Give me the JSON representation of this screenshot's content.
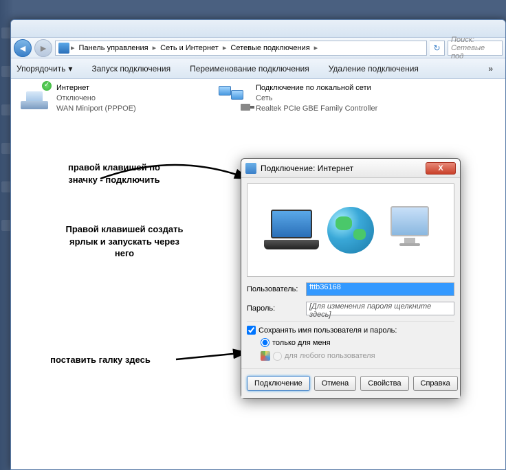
{
  "breadcrumb": {
    "items": [
      "Панель управления",
      "Сеть и Интернет",
      "Сетевые подключения"
    ]
  },
  "search": {
    "placeholder": "Поиск: Сетевые под"
  },
  "toolbar": {
    "organize": "Упорядочить",
    "start": "Запуск подключения",
    "rename": "Переименование подключения",
    "delete": "Удаление подключения",
    "more": "»"
  },
  "connections": {
    "internet": {
      "name": "Интернет",
      "status": "Отключено",
      "device": "WAN Miniport (PPPOE)"
    },
    "lan": {
      "name": "Подключение по локальной сети",
      "status": "Сеть",
      "device": "Realtek PCIe GBE Family Controller"
    }
  },
  "annotations": {
    "a1": "правой клавишей по значку - подключить",
    "a2": "Правой клавишей создать ярлык и запускать через него",
    "a3": "поставить галку здесь"
  },
  "dialog": {
    "title": "Подключение: Интернет",
    "user_label": "Пользователь:",
    "user_value": "fttb36168",
    "pass_label": "Пароль:",
    "pass_placeholder": "[Для изменения пароля щелкните здесь]",
    "save_cred": "Сохранять имя пользователя и пароль:",
    "only_me": "только для меня",
    "any_user": "для любого пользователя",
    "buttons": {
      "connect": "Подключение",
      "cancel": "Отмена",
      "props": "Свойства",
      "help": "Справка"
    }
  }
}
